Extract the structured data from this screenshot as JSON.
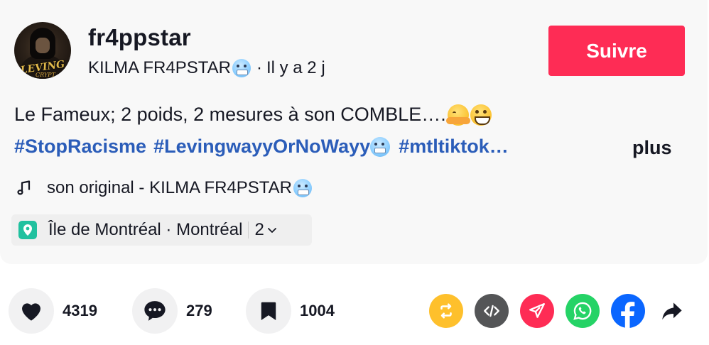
{
  "author": {
    "username": "fr4ppstar",
    "display_name": "KILMA FR4PSTAR",
    "display_name_emoji": "cold-face-emoji",
    "separator": "·",
    "time_ago": "Il y a 2 j",
    "avatar_text": "LEVING",
    "avatar_subtext": "CRYPT"
  },
  "follow_button": {
    "label": "Suivre",
    "color": "#fe2c55"
  },
  "caption": {
    "text": "Le Fameux; 2 poids, 2 mesures à son COMBLE….",
    "emojis": [
      "hugging-face-emoji",
      "grinning-face-emoji"
    ]
  },
  "hashtags": {
    "items": [
      "#StopRacisme",
      "#LevingwayyOrNoWayy",
      "#mtltiktok…"
    ],
    "color": "#2b5db9",
    "more_label": "plus"
  },
  "music": {
    "icon": "music-note-icon",
    "label": "son original - KILMA FR4PSTAR"
  },
  "location": {
    "icon": "location-pin-icon",
    "label": "Île de Montréal · Montréal",
    "count": "2",
    "icon_color": "#20c19f"
  },
  "actions": {
    "like": {
      "icon": "heart-icon",
      "count": "4319"
    },
    "comment": {
      "icon": "comment-icon",
      "count": "279"
    },
    "save": {
      "icon": "bookmark-icon",
      "count": "1004"
    }
  },
  "share_buttons": [
    {
      "icon": "repost-icon",
      "color": "#fec02c"
    },
    {
      "icon": "embed-icon",
      "color": "#545557"
    },
    {
      "icon": "send-icon",
      "color": "#fe2c55"
    },
    {
      "icon": "whatsapp-icon",
      "color": "#25d366"
    },
    {
      "icon": "facebook-icon",
      "color": "#0a66ff"
    },
    {
      "icon": "share-arrow-icon",
      "color": "#161823"
    }
  ]
}
